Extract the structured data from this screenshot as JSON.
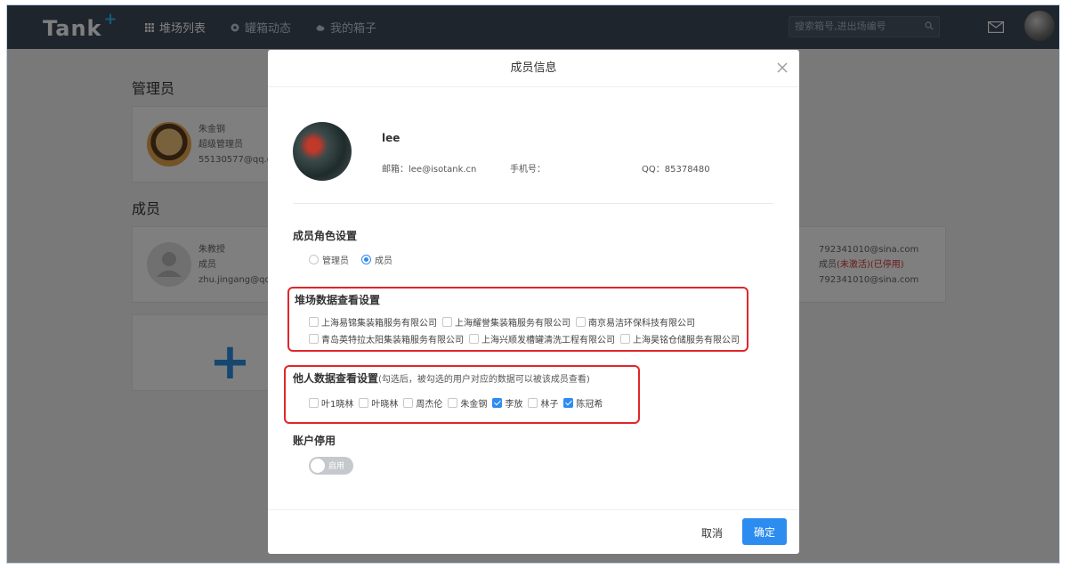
{
  "app": {
    "logo": "Tank",
    "logo_plus": "+",
    "nav": [
      "堆场列表",
      "罐箱动态",
      "我的箱子"
    ],
    "search_placeholder": "搜索箱号,进出场编号"
  },
  "background": {
    "admin_section": "管理员",
    "admin_card": {
      "name": "朱金钢",
      "role": "超级管理员",
      "email": "55130577@qq.co"
    },
    "member_section": "成员",
    "member_card": {
      "name": "朱教授",
      "role": "成员",
      "email": "zhu.jingang@qq.c"
    },
    "right_card": {
      "line1": "792341010@sina.com",
      "role_prefix": "成员",
      "role_status": "(未激活)(已停用)",
      "line3": "792341010@sina.com"
    },
    "add_symbol": "+"
  },
  "modal": {
    "title": "成员信息",
    "profile": {
      "name": "lee",
      "email": "邮箱：lee@isotank.cn",
      "phone": "手机号：",
      "qq": "QQ：85378480"
    },
    "role_section": {
      "title": "成员角色设置",
      "options": [
        "管理员",
        "成员"
      ],
      "selected": "成员"
    },
    "yard_section": {
      "title": "堆场数据查看设置",
      "row1": [
        "上海易锦集装箱服务有限公司",
        "上海耀誉集装箱服务有限公司",
        "南京易洁环保科技有限公司"
      ],
      "row2": [
        "青岛英特拉太阳集装箱服务有限公司",
        "上海兴顺发槽罐清洗工程有限公司",
        "上海昊铭仓储服务有限公司"
      ]
    },
    "others_section": {
      "title": "他人数据查看设置",
      "hint": "(勾选后，被勾选的用户对应的数据可以被该成员查看)",
      "users": [
        "叶1晓林",
        "叶晓林",
        "周杰伦",
        "朱金钢",
        "李放",
        "林子",
        "陈冠希"
      ],
      "checked": [
        false,
        false,
        false,
        false,
        true,
        false,
        true
      ]
    },
    "account_section": {
      "title": "账户停用",
      "toggle_label": "启用"
    },
    "footer": {
      "cancel": "取消",
      "ok": "确定"
    }
  },
  "colors": {
    "primary": "#2d8cf0",
    "highlight_box": "#e0262a",
    "topbar": "#3e4a59"
  }
}
